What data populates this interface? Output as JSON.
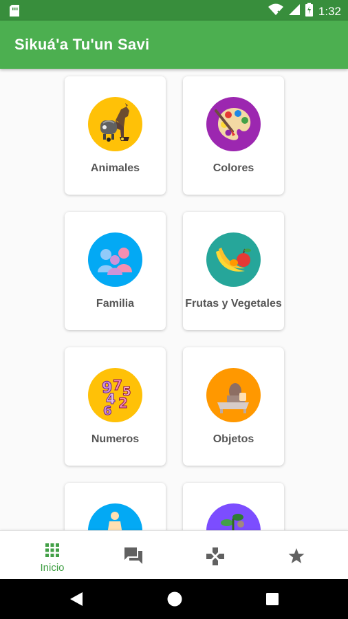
{
  "status_bar": {
    "time": "1:32"
  },
  "app_bar": {
    "title": "Sikuá'a Tu'un Savi"
  },
  "categories": [
    {
      "label": "Animales",
      "color": "#ffc107",
      "icon": "horse-icon"
    },
    {
      "label": "Colores",
      "color": "#9c27b0",
      "icon": "palette-icon"
    },
    {
      "label": "Familia",
      "color": "#03a9f4",
      "icon": "family-icon"
    },
    {
      "label": "Frutas y Vegetales",
      "color": "#26a69a",
      "icon": "fruits-icon"
    },
    {
      "label": "Numeros",
      "color": "#ffc107",
      "icon": "numbers-icon"
    },
    {
      "label": "Objetos",
      "color": "#ff9800",
      "icon": "objects-icon"
    },
    {
      "label": "",
      "color": "#03a9f4",
      "icon": "human-body-icon"
    },
    {
      "label": "",
      "color": "#7c4dff",
      "icon": "plants-icon"
    }
  ],
  "bottom_nav": {
    "items": [
      {
        "label": "Inicio",
        "icon": "grid-icon",
        "active": true
      },
      {
        "label": "",
        "icon": "chat-icon",
        "active": false
      },
      {
        "label": "",
        "icon": "gamepad-icon",
        "active": false
      },
      {
        "label": "",
        "icon": "star-icon",
        "active": false
      }
    ],
    "active_color": "#43a047",
    "inactive_color": "#616161"
  }
}
